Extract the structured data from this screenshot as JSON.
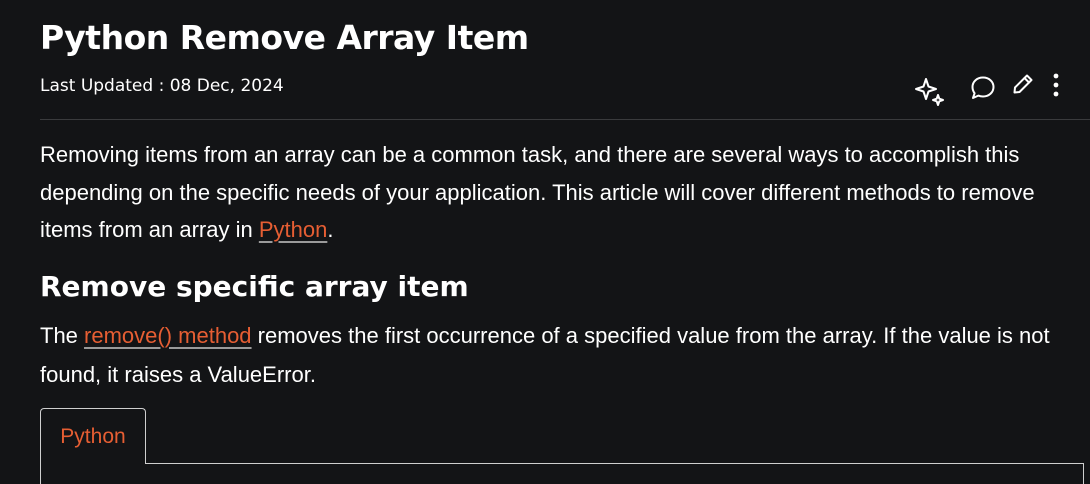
{
  "article": {
    "title": "Python Remove Array Item",
    "last_updated": "Last Updated : 08 Dec, 2024",
    "intro_text": "Removing items from an array can be a common task, and there are several ways to accomplish this depending on the specific needs of your application. This article will cover different methods to remove items from an array in ",
    "intro_link": "Python",
    "intro_end": "."
  },
  "section": {
    "heading": "Remove specific array item",
    "text_start": "The ",
    "link": "remove() method",
    "text_end": " removes the first occurrence of a specified value from the array. If the value is not found, it raises a ValueError."
  },
  "code": {
    "tabs": [
      "Python"
    ]
  },
  "actions": {
    "icons": [
      "ai-sparkle-icon",
      "comment-icon",
      "edit-icon",
      "more-options-icon"
    ]
  },
  "colors": {
    "background": "#131416",
    "link": "#e65e33",
    "text": "#ffffff",
    "border": "#cfcfcf"
  }
}
